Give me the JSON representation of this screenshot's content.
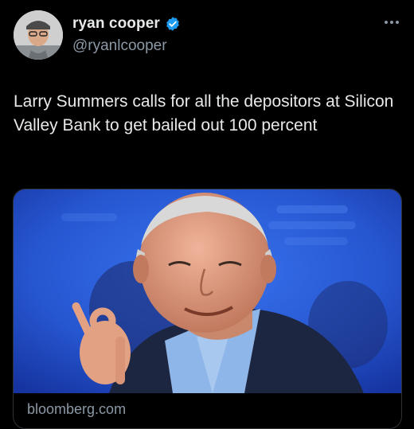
{
  "tweet": {
    "author": {
      "display_name": "ryan cooper",
      "handle": "@ryanlcooper",
      "verified": true,
      "verified_color": "#1d9bf0"
    },
    "more_icon": "more-horizontal-icon",
    "text": "Larry Summers calls for all the depositors at Silicon Valley Bank to get bailed out 100 percent",
    "link_card": {
      "domain": "bloomberg.com",
      "image_alt": "Photo of Larry Summers gesturing with an OK hand sign in front of a blue backdrop"
    }
  },
  "colors": {
    "background": "#000000",
    "text_primary": "#e7e9ea",
    "text_secondary": "#8b98a5",
    "card_border": "#2f3336",
    "photo_backdrop": "#2a5bd6"
  }
}
